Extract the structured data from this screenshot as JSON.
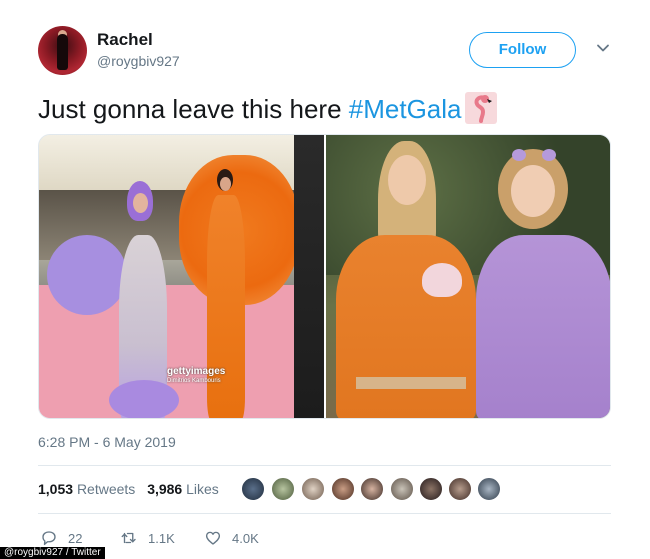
{
  "user": {
    "name": "Rachel",
    "handle": "@roygbiv927",
    "follow_label": "Follow"
  },
  "tweet": {
    "text_prefix": "Just gonna leave this here ",
    "hashtag": "#MetGala",
    "emoji_icon": "flamingo-emoji"
  },
  "media": {
    "watermark": "gettyimages",
    "watermark_credit": "Dimitrios Kambouris"
  },
  "timestamp": "6:28 PM - 6 May 2019",
  "stats": {
    "retweets_count": "1,053",
    "retweets_label": "Retweets",
    "likes_count": "3,986",
    "likes_label": "Likes"
  },
  "actions": {
    "reply_count": "22",
    "retweet_count": "1.1K",
    "like_count": "4.0K"
  },
  "credit": "@roygbiv927 / Twitter",
  "colors": {
    "accent": "#1da1f2",
    "hashtag": "#1b95e0",
    "muted": "#657786",
    "text": "#14171a"
  }
}
